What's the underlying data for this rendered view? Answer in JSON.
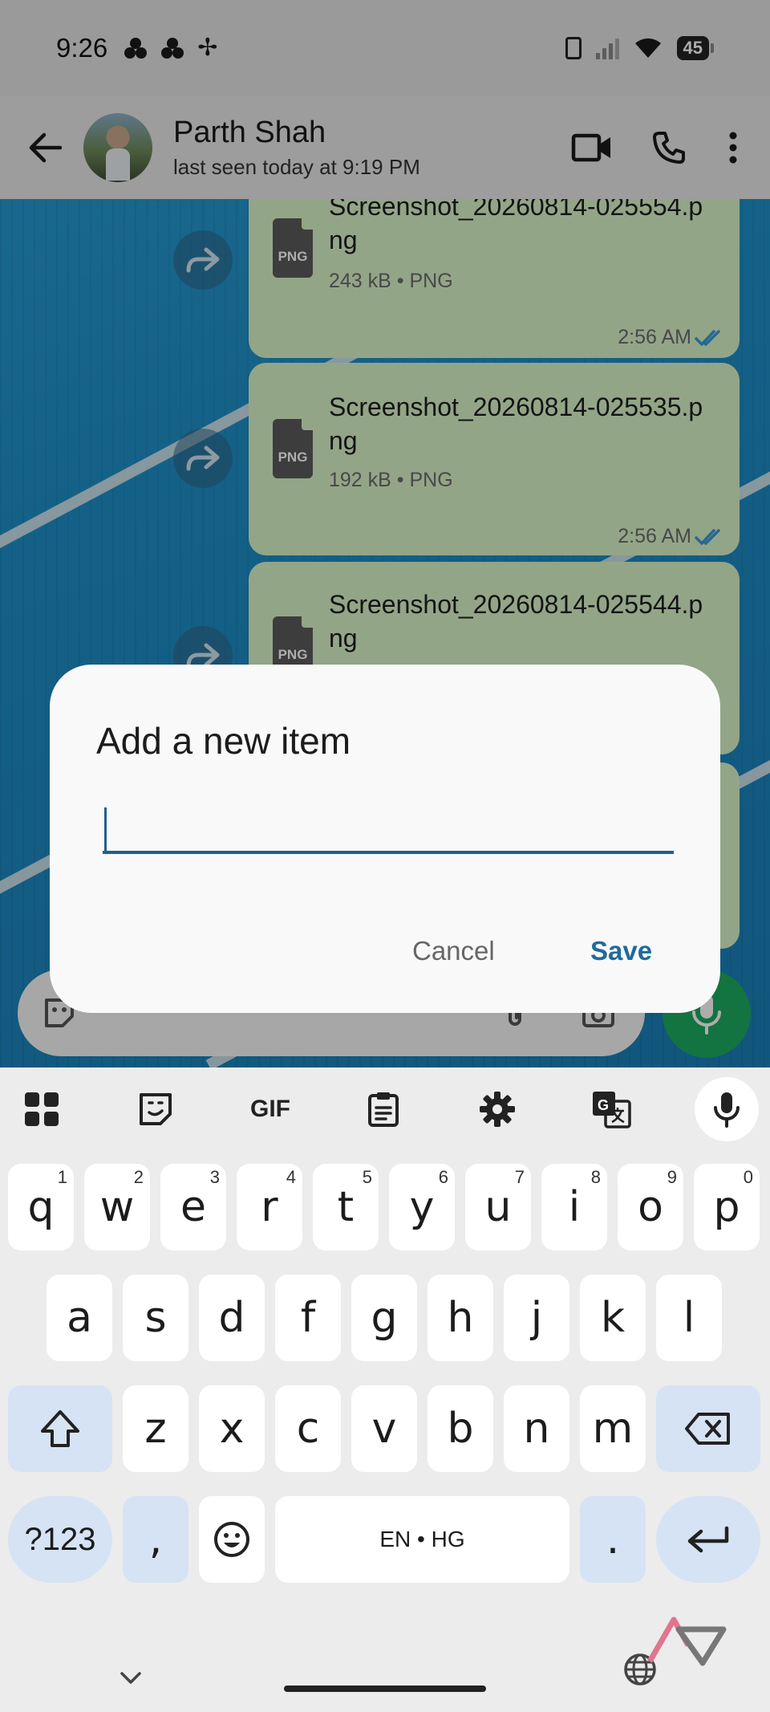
{
  "status_bar": {
    "time": "9:26",
    "battery": "45"
  },
  "header": {
    "contact_name": "Parth Shah",
    "last_seen": "last seen today at 9:19 PM"
  },
  "messages": [
    {
      "file_name": "Screenshot_20260814-025554.png",
      "meta": "243 kB • PNG",
      "time": "2:56 AM",
      "icon_label": "PNG"
    },
    {
      "file_name": "Screenshot_20260814-025535.png",
      "meta": "192 kB • PNG",
      "time": "2:56 AM",
      "icon_label": "PNG"
    },
    {
      "file_name": "Screenshot_20260814-025544.png",
      "meta": "",
      "time": "",
      "icon_label": "PNG"
    }
  ],
  "dialog": {
    "title": "Add a new item",
    "input_value": "",
    "cancel_label": "Cancel",
    "save_label": "Save"
  },
  "keyboard": {
    "toolbar": {
      "gif_label": "GIF"
    },
    "row1": [
      {
        "key": "q",
        "hint": "1"
      },
      {
        "key": "w",
        "hint": "2"
      },
      {
        "key": "e",
        "hint": "3"
      },
      {
        "key": "r",
        "hint": "4"
      },
      {
        "key": "t",
        "hint": "5"
      },
      {
        "key": "y",
        "hint": "6"
      },
      {
        "key": "u",
        "hint": "7"
      },
      {
        "key": "i",
        "hint": "8"
      },
      {
        "key": "o",
        "hint": "9"
      },
      {
        "key": "p",
        "hint": "0"
      }
    ],
    "row2": [
      "a",
      "s",
      "d",
      "f",
      "g",
      "h",
      "j",
      "k",
      "l"
    ],
    "row3": [
      "z",
      "x",
      "c",
      "v",
      "b",
      "n",
      "m"
    ],
    "symbols_label": "?123",
    "comma_label": ",",
    "space_label": "EN • HG",
    "period_label": "."
  },
  "colors": {
    "bubble": "#d9f4c7",
    "accent": "#1f6a9a",
    "mic_fab": "#1daa61"
  }
}
